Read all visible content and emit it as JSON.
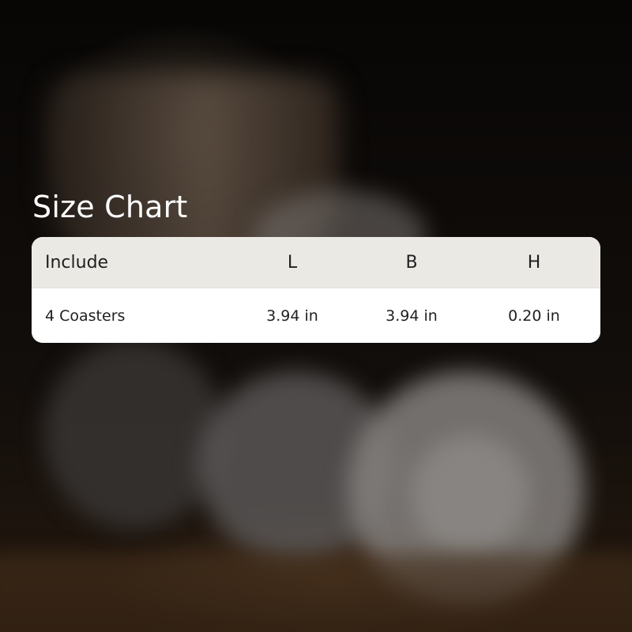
{
  "title": "Size Chart",
  "table": {
    "headers": [
      "Include",
      "L",
      "B",
      "H"
    ],
    "rows": [
      [
        "4 Coasters",
        "3.94 in",
        "3.94 in",
        "0.20 in"
      ]
    ]
  },
  "colors": {
    "header_background": "#ebe9e4",
    "card_background": "#ffffff",
    "text": "#1f1f1f",
    "title": "#ffffff"
  }
}
